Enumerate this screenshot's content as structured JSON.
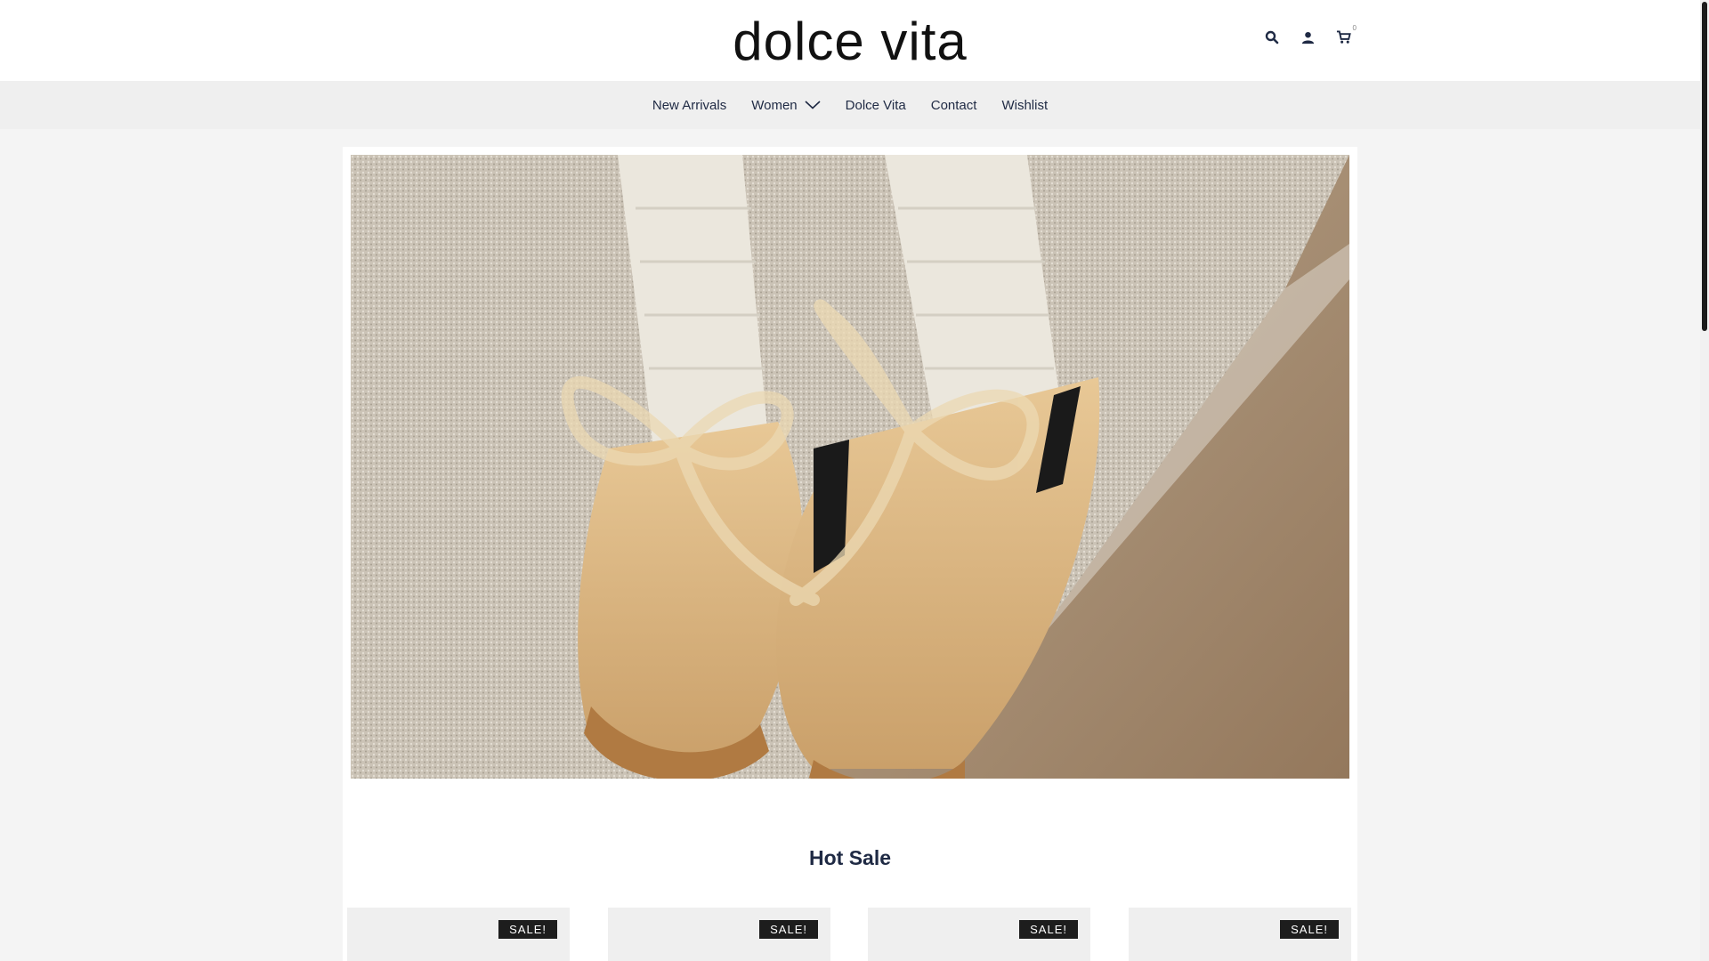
{
  "header": {
    "logo": "dolce vita",
    "icons": [
      "search-icon",
      "user-icon",
      "cart-icon"
    ],
    "cart_count": "0"
  },
  "nav": {
    "items": [
      {
        "label": "New Arrivals"
      },
      {
        "label": "Women",
        "has_dropdown": true
      },
      {
        "label": "Dolce Vita"
      },
      {
        "label": "Contact"
      },
      {
        "label": "Wishlist"
      }
    ]
  },
  "hero": {
    "image": "sneakers-with-ribbon-laces-photo"
  },
  "hot_sale": {
    "title": "Hot Sale",
    "products": [
      {
        "badge": "SALE!"
      },
      {
        "badge": "SALE!"
      },
      {
        "badge": "SALE!"
      },
      {
        "badge": "SALE!"
      }
    ]
  },
  "colors": {
    "nav_bg": "#efefef",
    "text": "#1f2a44",
    "badge_bg": "#1d1d1d"
  }
}
